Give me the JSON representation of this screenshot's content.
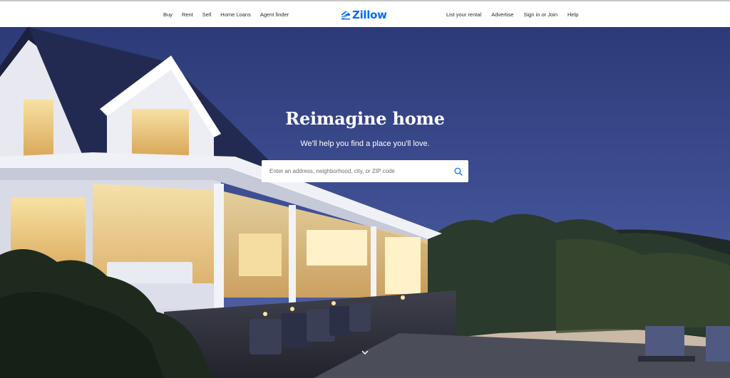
{
  "nav": {
    "left": [
      {
        "label": "Buy"
      },
      {
        "label": "Rent"
      },
      {
        "label": "Sell"
      },
      {
        "label": "Home Loans"
      },
      {
        "label": "Agent finder"
      }
    ],
    "right": [
      {
        "label": "List your rental"
      },
      {
        "label": "Advertise"
      },
      {
        "label": "Sign in or Join"
      },
      {
        "label": "Help"
      }
    ]
  },
  "logo": {
    "text": "Zillow",
    "icon": "zillow-z-house-icon",
    "color": "#006aff"
  },
  "hero": {
    "headline": "Reimagine home",
    "subheadline": "We'll help you find a place you'll love.",
    "search": {
      "placeholder": "Enter an address, neighborhood, city, or ZIP code",
      "value": "",
      "icon": "search-icon"
    },
    "scroll_icon": "chevron-down-icon"
  },
  "colors": {
    "brand": "#006aff",
    "nav_text": "#2a2a33",
    "sky": "#3b4a8c"
  }
}
